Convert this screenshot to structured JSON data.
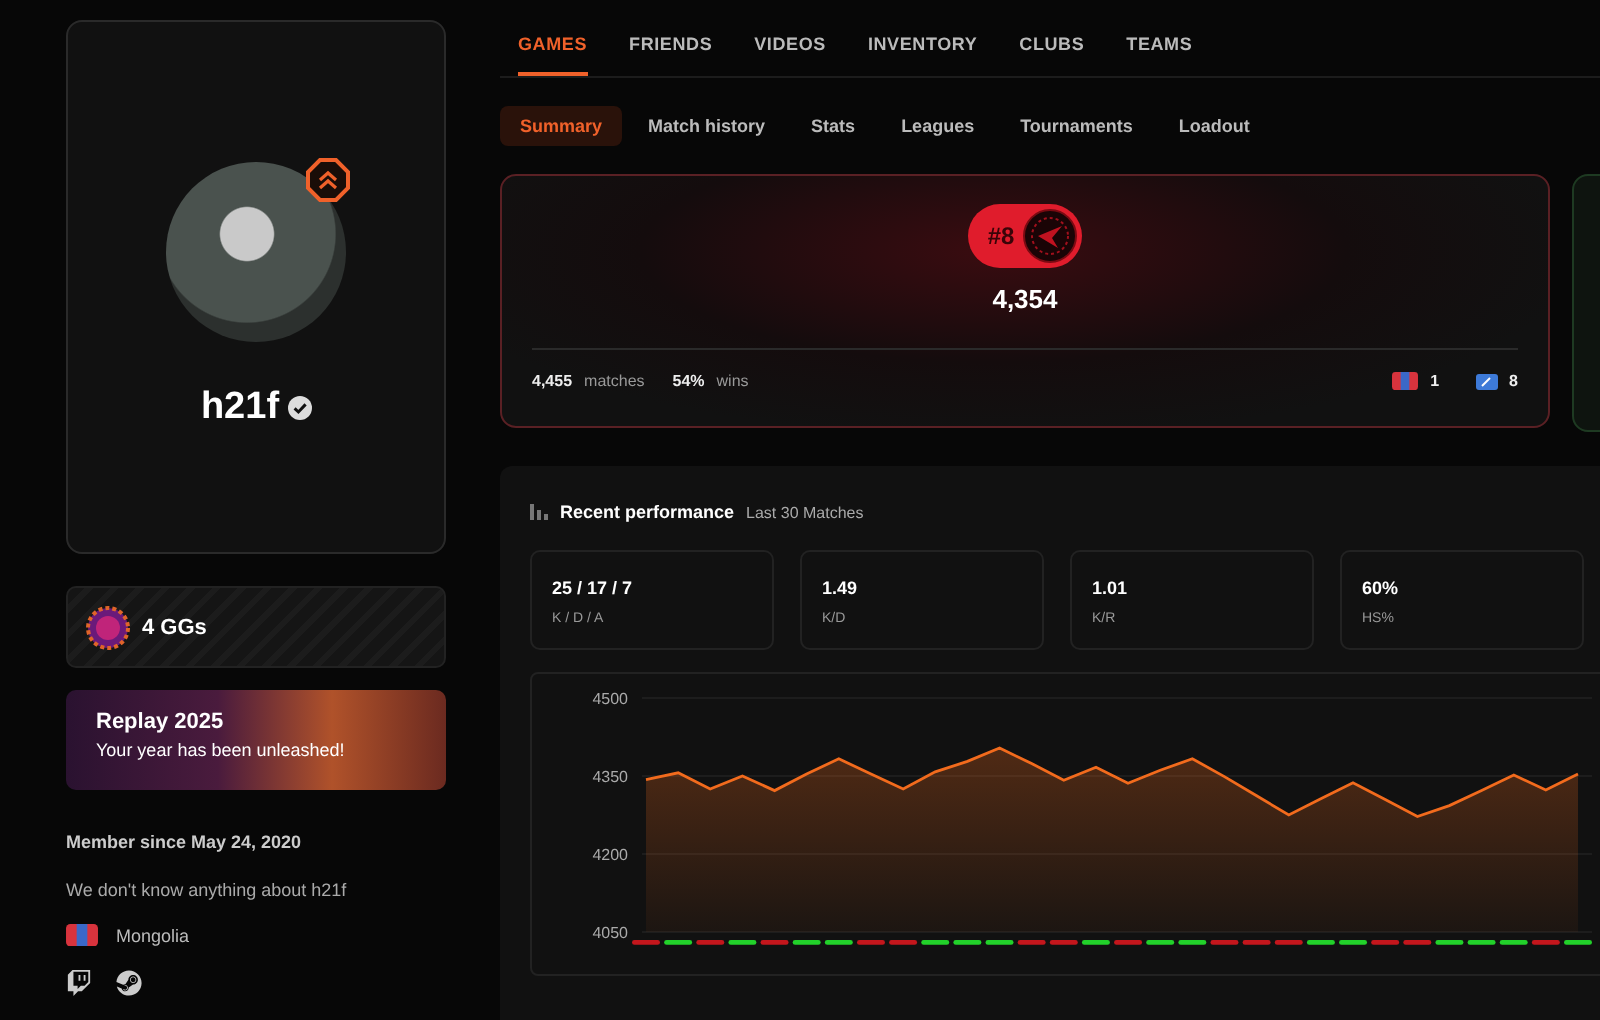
{
  "tabs": [
    {
      "label": "GAMES",
      "selected": true
    },
    {
      "label": "FRIENDS",
      "selected": false
    },
    {
      "label": "VIDEOS",
      "selected": false
    },
    {
      "label": "INVENTORY",
      "selected": false
    },
    {
      "label": "CLUBS",
      "selected": false
    },
    {
      "label": "TEAMS",
      "selected": false
    }
  ],
  "subtabs": [
    {
      "label": "Summary",
      "selected": true
    },
    {
      "label": "Match history",
      "selected": false
    },
    {
      "label": "Stats",
      "selected": false
    },
    {
      "label": "Leagues",
      "selected": false
    },
    {
      "label": "Tournaments",
      "selected": false
    },
    {
      "label": "Loadout",
      "selected": false
    }
  ],
  "profile": {
    "username": "h21f",
    "verified": true
  },
  "ggs": {
    "label": "4 GGs"
  },
  "replay": {
    "title": "Replay 2025",
    "subtitle": "Your year has been unleashed!"
  },
  "about": {
    "member_since": "Member since May 24, 2020",
    "bio": "We don't know anything about h21f",
    "country": "Mongolia"
  },
  "rank": {
    "position": "#8",
    "rating": "4,354",
    "matches": "4,455",
    "matches_label": "matches",
    "winrate": "54%",
    "winrate_label": "wins",
    "country_rank": "1",
    "region_rank": "8"
  },
  "performance": {
    "title": "Recent performance",
    "subtitle": "Last 30 Matches",
    "stats": [
      {
        "value": "25 / 17 / 7",
        "label": "K / D / A"
      },
      {
        "value": "1.49",
        "label": "K/D"
      },
      {
        "value": "1.01",
        "label": "K/R"
      },
      {
        "value": "60%",
        "label": "HS%"
      }
    ],
    "chart_data": {
      "type": "area",
      "ylim": [
        4050,
        4500
      ],
      "yticks": [
        4050,
        4200,
        4350,
        4500
      ],
      "series": [
        {
          "color": "#f26b1d",
          "values": [
            4343,
            4356,
            4325,
            4350,
            4322,
            4354,
            4383,
            4354,
            4325,
            4358,
            4378,
            4404,
            4374,
            4342,
            4367,
            4336,
            4361,
            4383,
            4349,
            4312,
            4275,
            4306,
            4337,
            4305,
            4272,
            4293,
            4322,
            4352,
            4323,
            4354
          ]
        }
      ]
    },
    "results": [
      {
        "kind": "loss"
      },
      {
        "kind": "win"
      },
      {
        "kind": "loss"
      },
      {
        "kind": "win"
      },
      {
        "kind": "loss"
      },
      {
        "kind": "win"
      },
      {
        "kind": "win"
      },
      {
        "kind": "loss"
      },
      {
        "kind": "loss"
      },
      {
        "kind": "win"
      },
      {
        "kind": "win"
      },
      {
        "kind": "win"
      },
      {
        "kind": "loss"
      },
      {
        "kind": "loss"
      },
      {
        "kind": "win"
      },
      {
        "kind": "loss"
      },
      {
        "kind": "win"
      },
      {
        "kind": "win"
      },
      {
        "kind": "loss"
      },
      {
        "kind": "loss"
      },
      {
        "kind": "loss"
      },
      {
        "kind": "win"
      },
      {
        "kind": "win"
      },
      {
        "kind": "loss"
      },
      {
        "kind": "loss"
      },
      {
        "kind": "win"
      },
      {
        "kind": "win"
      },
      {
        "kind": "win"
      },
      {
        "kind": "loss"
      },
      {
        "kind": "win"
      }
    ]
  }
}
